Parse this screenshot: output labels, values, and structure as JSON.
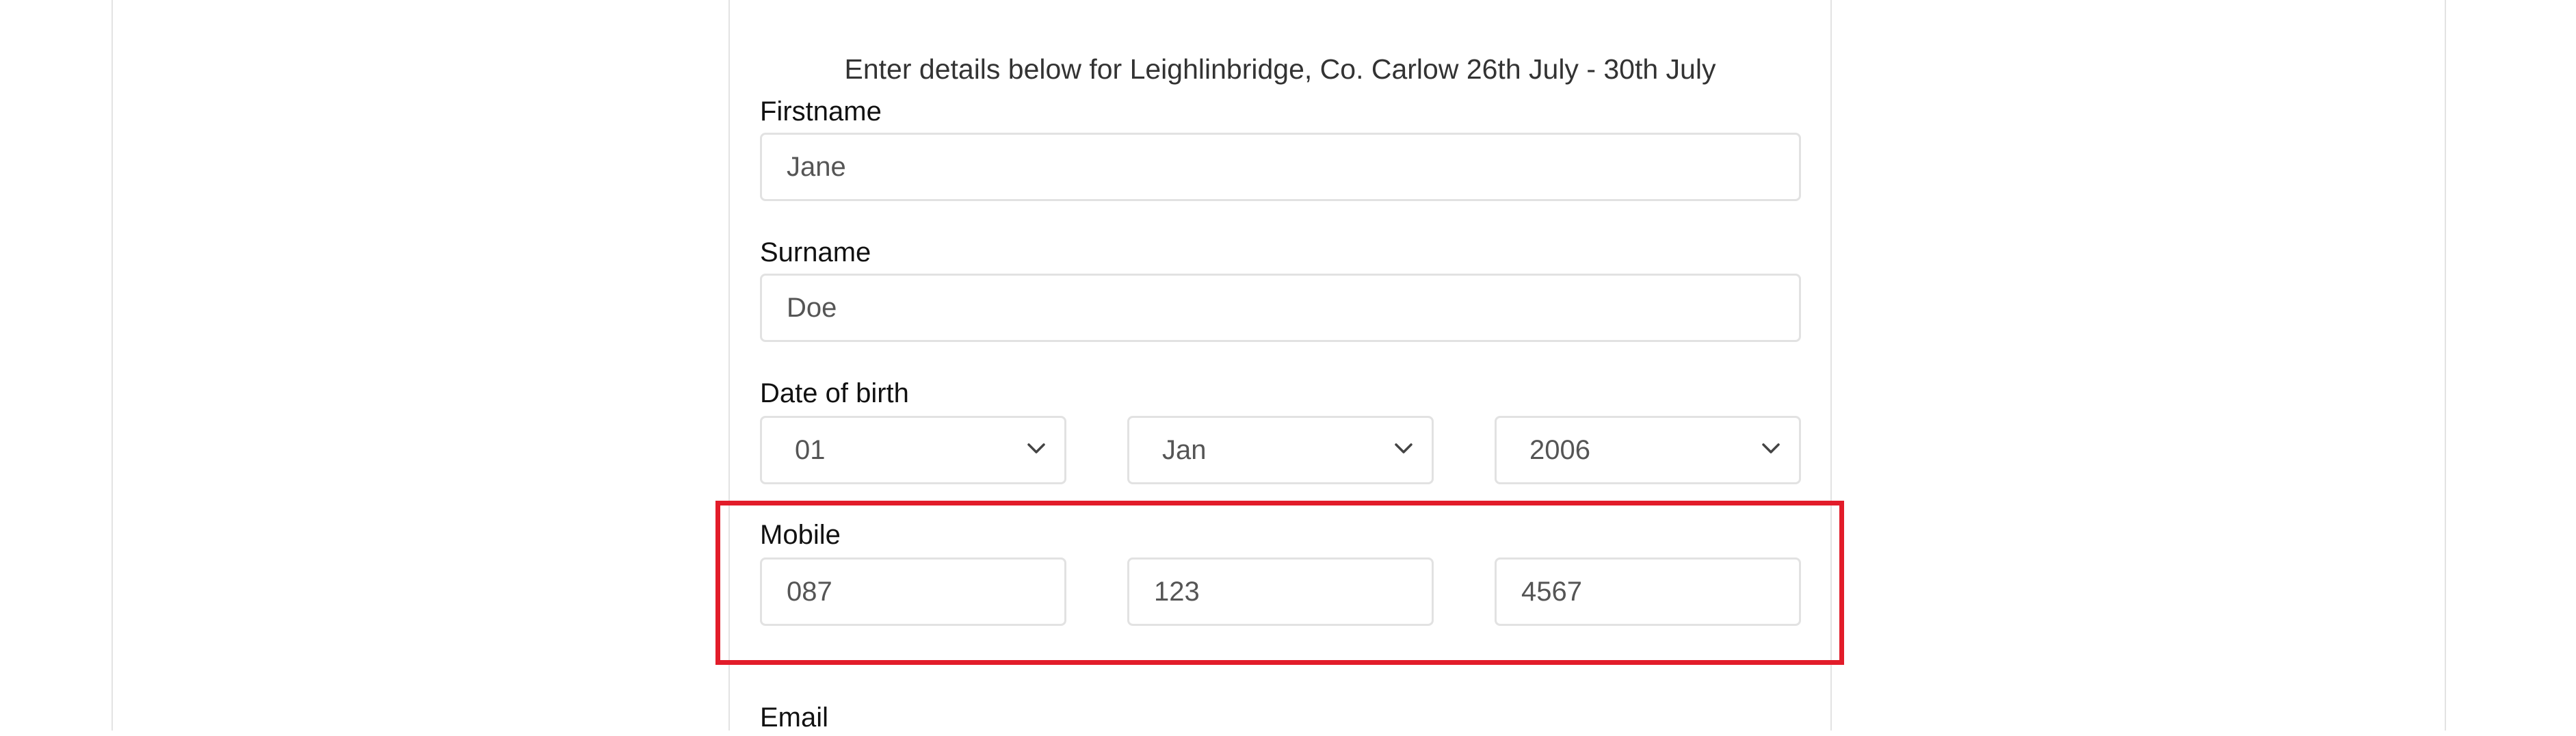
{
  "form": {
    "intro_text": "Enter details below for Leighlinbridge, Co. Carlow 26th July - 30th July",
    "firstname": {
      "label": "Firstname",
      "value": "Jane"
    },
    "surname": {
      "label": "Surname",
      "value": "Doe"
    },
    "dob": {
      "label": "Date of birth",
      "day": "01",
      "month": "Jan",
      "year": "2006"
    },
    "mobile": {
      "label": "Mobile",
      "part1": "087",
      "part2": "123",
      "part3": "4567"
    },
    "email": {
      "label": "Email"
    }
  },
  "colors": {
    "highlight": "#e21c2a",
    "input_border": "#e2e2e2"
  },
  "icons": {
    "select_arrow": "chevron-down-icon"
  }
}
